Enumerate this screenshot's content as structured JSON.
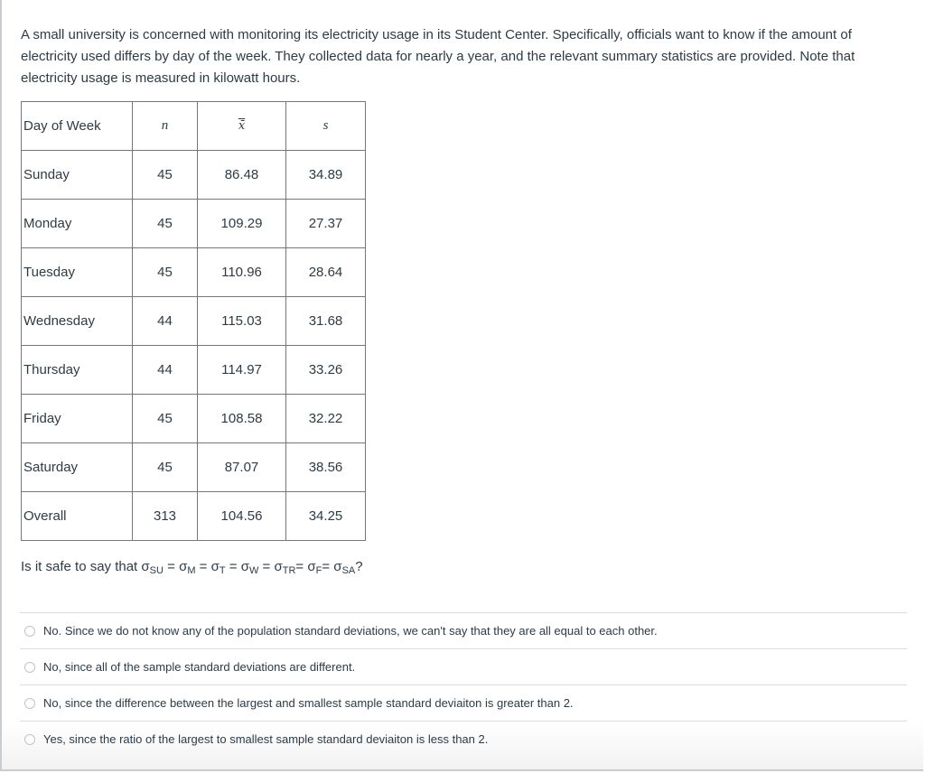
{
  "prompt": "A small university is concerned with monitoring its electricity usage in its Student Center. Specifically, officials want to know if the amount of electricity used differs by day of the week. They collected data for nearly a year, and the relevant summary statistics are provided. Note that electricity usage is measured in kilowatt hours.",
  "table": {
    "headers": [
      "Day of Week",
      "n",
      "x̄",
      "s"
    ],
    "rows": [
      {
        "day": "Sunday",
        "n": "45",
        "mean": "86.48",
        "s": "34.89"
      },
      {
        "day": "Monday",
        "n": "45",
        "mean": "109.29",
        "s": "27.37"
      },
      {
        "day": "Tuesday",
        "n": "45",
        "mean": "110.96",
        "s": "28.64"
      },
      {
        "day": "Wednesday",
        "n": "44",
        "mean": "115.03",
        "s": "31.68"
      },
      {
        "day": "Thursday",
        "n": "44",
        "mean": "114.97",
        "s": "33.26"
      },
      {
        "day": "Friday",
        "n": "45",
        "mean": "108.58",
        "s": "32.22"
      },
      {
        "day": "Saturday",
        "n": "45",
        "mean": "87.07",
        "s": "38.56"
      },
      {
        "day": "Overall",
        "n": "313",
        "mean": "104.56",
        "s": "34.25"
      }
    ]
  },
  "question": {
    "prefix": "Is it safe to say that ",
    "sigma": "σ",
    "subscripts": [
      "SU",
      "M",
      "T",
      "W",
      "TR",
      "F",
      "SA"
    ],
    "suffix": "?"
  },
  "answers": [
    {
      "label": "No. Since we do not know any of the population standard deviations, we can't say that they are all equal to each other.",
      "selected": false
    },
    {
      "label": "No, since all of the sample standard deviations are different.",
      "selected": false
    },
    {
      "label": "No, since the difference between the largest and smallest sample standard deviaiton is greater than 2.",
      "selected": false
    },
    {
      "label": "Yes, since the ratio of the largest to smallest sample standard deviaiton is less than 2.",
      "selected": false
    }
  ]
}
